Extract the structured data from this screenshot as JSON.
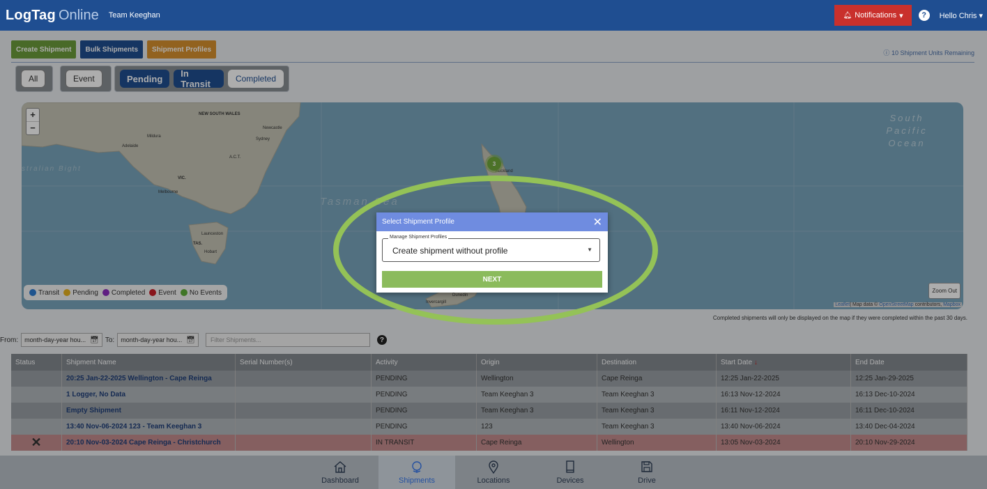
{
  "header": {
    "logo_main": "LogTag",
    "logo_suffix": "Online",
    "team": "Team Keeghan",
    "notifications_label": "Notifications",
    "help_icon": "question-icon",
    "user_label": "Hello Chris"
  },
  "toolbar": {
    "create_shipment": "Create Shipment",
    "bulk_shipments": "Bulk Shipments",
    "shipment_profiles": "Shipment Profiles",
    "remaining": "10 Shipment Units Remaining"
  },
  "filters": {
    "all": "All",
    "event": "Event",
    "pending": "Pending",
    "in_transit": "In Transit",
    "completed": "Completed"
  },
  "map": {
    "zoom_in": "+",
    "zoom_out": "−",
    "labels": {
      "nsw": "NEW SOUTH WALES",
      "newcastle": "Newcastle",
      "sydney": "Sydney",
      "mildura": "Mildura",
      "adelaide": "Adelaide",
      "act": "A.C.T.",
      "vic": "VIC.",
      "melbourne": "Melbourne",
      "bight": "stralian Bight",
      "launceston": "Launceston",
      "tas": "TAS.",
      "hobart": "Hobart",
      "auckland": "Auckland",
      "dunedin": "Dunedin",
      "invercargill": "Invercargill",
      "tasman": "Tasman Sea",
      "pacific": "South Pacific Ocean"
    },
    "cluster_count": "3",
    "legend": [
      {
        "label": "Transit",
        "color": "#2f7dd1"
      },
      {
        "label": "Pending",
        "color": "#e8b320"
      },
      {
        "label": "Completed",
        "color": "#8d2fc0"
      },
      {
        "label": "Event",
        "color": "#c91f2a"
      },
      {
        "label": "No Events",
        "color": "#5fae3a"
      }
    ],
    "zoom_out_button": "Zoom Out",
    "attribution_leaflet": "Leaflet",
    "attribution_text": "| Map data © ",
    "attribution_osm": "OpenStreetMap",
    "attribution_contrib": " contributors, ",
    "attribution_mapbox": "Mapbox"
  },
  "note": "Completed shipments will only be displayed on the map if they were completed within the past 30 days.",
  "date_filter": {
    "from_label": "From:",
    "from_placeholder": "month-day-year hou...",
    "to_label": "To:",
    "to_placeholder": "month-day-year hou...",
    "search_placeholder": "Filter Shipments..."
  },
  "table": {
    "columns": [
      "Status",
      "Shipment Name",
      "Serial Number(s)",
      "Activity",
      "Origin",
      "Destination",
      "Start Date",
      "End Date"
    ],
    "sort_indicator": "↓",
    "rows": [
      {
        "status": "",
        "name": "20:25 Jan-22-2025 Wellington - Cape Reinga",
        "serial": "",
        "activity": "PENDING",
        "origin": "Wellington",
        "destination": "Cape Reinga",
        "start": "12:25 Jan-22-2025",
        "end": "12:25 Jan-29-2025"
      },
      {
        "status": "",
        "name": "1 Logger, No Data",
        "serial": "",
        "activity": "PENDING",
        "origin": "Team Keeghan 3",
        "destination": "Team Keeghan 3",
        "start": "16:13 Nov-12-2024",
        "end": "16:13 Dec-10-2024"
      },
      {
        "status": "",
        "name": "Empty Shipment",
        "serial": "",
        "activity": "PENDING",
        "origin": "Team Keeghan 3",
        "destination": "Team Keeghan 3",
        "start": "16:11 Nov-12-2024",
        "end": "16:11 Dec-10-2024"
      },
      {
        "status": "",
        "name": "13:40 Nov-06-2024 123 - Team Keeghan 3",
        "serial": "",
        "activity": "PENDING",
        "origin": "123",
        "destination": "Team Keeghan 3",
        "start": "13:40 Nov-06-2024",
        "end": "13:40 Dec-04-2024"
      },
      {
        "status": "✕",
        "name": "20:10 Nov-03-2024 Cape Reinga - Christchurch",
        "serial": "",
        "activity": "IN TRANSIT",
        "origin": "Cape Reinga",
        "destination": "Wellington",
        "start": "13:05 Nov-03-2024",
        "end": "20:10 Nov-29-2024"
      }
    ]
  },
  "bottom_nav": [
    {
      "label": "Dashboard",
      "icon": "home-icon",
      "active": false
    },
    {
      "label": "Shipments",
      "icon": "globe-icon",
      "active": true
    },
    {
      "label": "Locations",
      "icon": "location-pin-icon",
      "active": false
    },
    {
      "label": "Devices",
      "icon": "device-icon",
      "active": false
    },
    {
      "label": "Drive",
      "icon": "save-drive-icon",
      "active": false
    }
  ],
  "modal": {
    "title": "Select Shipment Profile",
    "field_label": "Manage Shipment Profiles",
    "selected_value": "Create shipment without profile",
    "next_button": "NEXT"
  },
  "colors": {
    "brand_blue": "#1f4e91",
    "highlight_ellipse": "#94c257",
    "modal_header": "#6f8ce0",
    "next_button": "#8bbb5c"
  }
}
